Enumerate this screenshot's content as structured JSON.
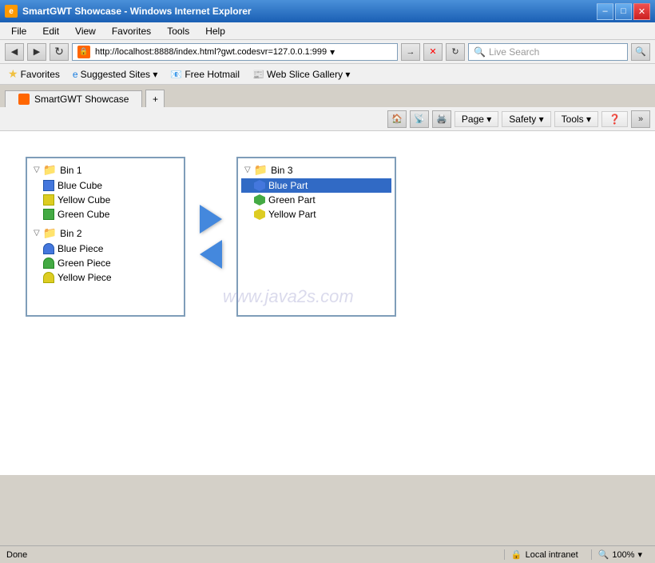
{
  "titlebar": {
    "title": "SmartGWT Showcase - Windows Internet Explorer",
    "icon": "IE",
    "buttons": {
      "minimize": "–",
      "maximize": "□",
      "close": "✕"
    }
  },
  "menubar": {
    "items": [
      "File",
      "Edit",
      "View",
      "Favorites",
      "Tools",
      "Help"
    ]
  },
  "addressbar": {
    "url": "http://localhost:8888/index.html?gwt.codesvr=127.0.0.1:999",
    "search_placeholder": "Live Search"
  },
  "favoritesbar": {
    "favorites_label": "Favorites",
    "items": [
      "Suggested Sites ▾",
      "Free Hotmail",
      "Web Slice Gallery ▾"
    ]
  },
  "tab": {
    "label": "SmartGWT Showcase"
  },
  "toolbar": {
    "items": [
      "Page ▾",
      "Safety ▾",
      "Tools ▾",
      "❓"
    ]
  },
  "left_panel": {
    "bin1": {
      "label": "Bin 1",
      "items": [
        {
          "name": "Blue Cube",
          "color": "blue",
          "type": "cube"
        },
        {
          "name": "Yellow Cube",
          "color": "yellow",
          "type": "cube"
        },
        {
          "name": "Green Cube",
          "color": "green",
          "type": "cube"
        }
      ]
    },
    "bin2": {
      "label": "Bin 2",
      "items": [
        {
          "name": "Blue Piece",
          "color": "blue",
          "type": "piece"
        },
        {
          "name": "Green Piece",
          "color": "green",
          "type": "piece"
        },
        {
          "name": "Yellow Piece",
          "color": "yellow",
          "type": "piece"
        }
      ]
    }
  },
  "right_panel": {
    "bin3": {
      "label": "Bin 3",
      "items": [
        {
          "name": "Blue Part",
          "color": "blue",
          "type": "part",
          "selected": true
        },
        {
          "name": "Green Part",
          "color": "green",
          "type": "part"
        },
        {
          "name": "Yellow Part",
          "color": "yellow",
          "type": "part"
        }
      ]
    }
  },
  "watermark": "www.java2s.com",
  "statusbar": {
    "left": "Done",
    "zone": "Local intranet",
    "zoom": "100%"
  }
}
